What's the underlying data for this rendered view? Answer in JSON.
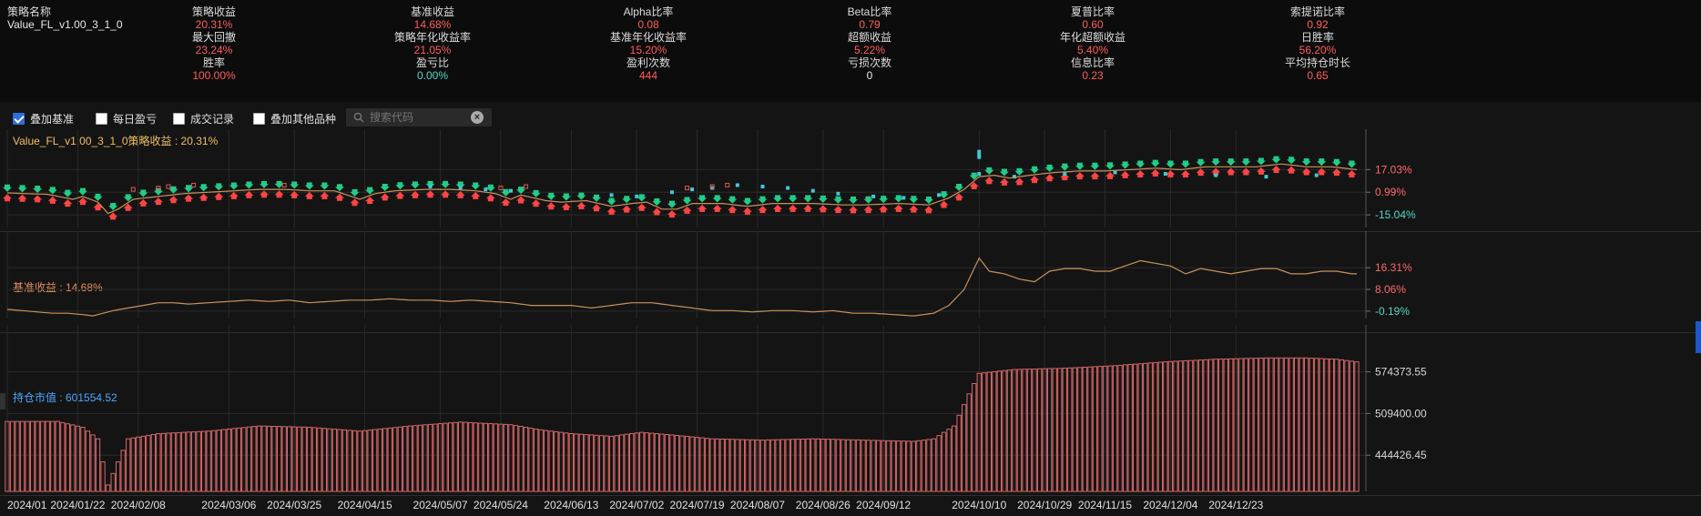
{
  "strategy": {
    "name_label": "策略名称",
    "name_value": "Value_FL_v1.00_3_1_0"
  },
  "stats": [
    {
      "label": "策略收益",
      "value": "20.31%",
      "color": "red"
    },
    {
      "label": "基准收益",
      "value": "14.68%",
      "color": "red"
    },
    {
      "label": "Alpha比率",
      "value": "0.08",
      "color": "red"
    },
    {
      "label": "Beta比率",
      "value": "0.79",
      "color": "red"
    },
    {
      "label": "夏普比率",
      "value": "0.60",
      "color": "red"
    },
    {
      "label": "索提诺比率",
      "value": "0.92",
      "color": "red"
    },
    {
      "label": "最大回撤",
      "value": "23.24%",
      "color": "red"
    },
    {
      "label": "策略年化收益率",
      "value": "21.05%",
      "color": "red"
    },
    {
      "label": "基准年化收益率",
      "value": "15.20%",
      "color": "red"
    },
    {
      "label": "超额收益",
      "value": "5.22%",
      "color": "red"
    },
    {
      "label": "年化超额收益",
      "value": "5.40%",
      "color": "red"
    },
    {
      "label": "日胜率",
      "value": "56.20%",
      "color": "red"
    },
    {
      "label": "胜率",
      "value": "100.00%",
      "color": "red"
    },
    {
      "label": "盈亏比",
      "value": "0.00%",
      "color": "teal"
    },
    {
      "label": "盈利次数",
      "value": "444",
      "color": "red"
    },
    {
      "label": "亏损次数",
      "value": "0",
      "color": "white"
    },
    {
      "label": "信息比率",
      "value": "0.23",
      "color": "red"
    },
    {
      "label": "平均持仓时长",
      "value": "0.65",
      "color": "red"
    }
  ],
  "toolbar": {
    "overlay_benchmark": {
      "label": "叠加基准",
      "checked": true
    },
    "daily_pnl": {
      "label": "每日盈亏",
      "checked": false
    },
    "trade_records": {
      "label": "成交记录",
      "checked": false
    },
    "overlay_other": {
      "label": "叠加其他品种",
      "checked": false
    },
    "search_placeholder": "搜索代码"
  },
  "panels": {
    "strategy_title": "Value_FL_v1.00_3_1_0策略收益 : 20.31%",
    "benchmark_title": "基准收益 : 14.68%",
    "position_title": "持仓市值 : 601554.52"
  },
  "colors": {
    "up": "#ff4444",
    "down": "#22cc88",
    "line": "#c8925a",
    "dash": "#40c8d8",
    "bar": "#d86868",
    "grid": "#2a2a2a"
  },
  "chart_data": [
    {
      "type": "line",
      "name": "strategy",
      "title": "Value_FL_v1.00_3_1_0策略收益 : 20.31%",
      "ytick_labels": [
        "17.03%",
        "0.99%",
        "-15.04%"
      ],
      "ytick_values": [
        17.03,
        0.99,
        -15.04
      ],
      "ylim": [
        -24,
        34
      ],
      "points": [
        [
          0,
          0.5
        ],
        [
          4,
          0
        ],
        [
          8,
          -0.5
        ],
        [
          13,
          -4
        ],
        [
          15,
          -2
        ],
        [
          18,
          -6
        ],
        [
          20,
          -14
        ],
        [
          22,
          -11
        ],
        [
          25,
          -4
        ],
        [
          30,
          -2
        ],
        [
          35,
          0
        ],
        [
          40,
          1
        ],
        [
          45,
          2
        ],
        [
          50,
          3
        ],
        [
          55,
          3
        ],
        [
          60,
          2
        ],
        [
          65,
          2
        ],
        [
          70,
          -4
        ],
        [
          73,
          0
        ],
        [
          77,
          2
        ],
        [
          83,
          3
        ],
        [
          88,
          3
        ],
        [
          93,
          2
        ],
        [
          97,
          0
        ],
        [
          100,
          -4
        ],
        [
          102,
          -1
        ],
        [
          107,
          -5
        ],
        [
          110,
          -6
        ],
        [
          115,
          -5
        ],
        [
          120,
          -9
        ],
        [
          124,
          -7
        ],
        [
          127,
          -6
        ],
        [
          130,
          -11
        ],
        [
          133,
          -11
        ],
        [
          136,
          -7
        ],
        [
          142,
          -7
        ],
        [
          147,
          -9
        ],
        [
          152,
          -7
        ],
        [
          160,
          -7
        ],
        [
          166,
          -8
        ],
        [
          170,
          -8
        ],
        [
          177,
          -7
        ],
        [
          183,
          -8
        ],
        [
          187,
          -3
        ],
        [
          190,
          3
        ],
        [
          193,
          12
        ],
        [
          196,
          13
        ],
        [
          199,
          11
        ],
        [
          203,
          13
        ],
        [
          208,
          15
        ],
        [
          213,
          16
        ],
        [
          218,
          16
        ],
        [
          223,
          17
        ],
        [
          228,
          18
        ],
        [
          233,
          17
        ],
        [
          238,
          19
        ],
        [
          243,
          19
        ],
        [
          248,
          19
        ],
        [
          253,
          21
        ],
        [
          258,
          19
        ],
        [
          263,
          19
        ],
        [
          268,
          17
        ]
      ],
      "marker_offset_up": -4,
      "marker_offset_down": 4,
      "dash_series": [
        [
          84,
          5
        ],
        [
          90,
          4
        ],
        [
          95,
          3
        ],
        [
          100,
          2
        ],
        [
          120,
          -1
        ],
        [
          125,
          -2
        ],
        [
          132,
          1
        ],
        [
          136,
          3
        ],
        [
          140,
          4
        ],
        [
          145,
          6
        ],
        [
          150,
          5
        ],
        [
          155,
          4
        ],
        [
          160,
          2
        ],
        [
          165,
          0
        ],
        [
          172,
          -2
        ],
        [
          178,
          -3
        ],
        [
          185,
          -1
        ],
        [
          193,
          14
        ],
        [
          200,
          12
        ],
        [
          210,
          14
        ],
        [
          220,
          15
        ],
        [
          230,
          14
        ],
        [
          240,
          13
        ],
        [
          250,
          12
        ],
        [
          260,
          13
        ]
      ],
      "red_square_points": [
        [
          25,
          3
        ],
        [
          30,
          4
        ],
        [
          32,
          5
        ],
        [
          37,
          6
        ],
        [
          55,
          6
        ],
        [
          98,
          4
        ],
        [
          103,
          5
        ],
        [
          135,
          4
        ],
        [
          140,
          5
        ],
        [
          143,
          6
        ]
      ]
    },
    {
      "type": "line",
      "name": "benchmark",
      "title": "基准收益 : 14.68%",
      "ytick_labels": [
        "16.31%",
        "8.06%",
        "-0.19%"
      ],
      "ytick_values": [
        16.31,
        8.06,
        -0.19
      ],
      "ylim": [
        -3,
        24
      ],
      "points": [
        [
          0,
          0.5
        ],
        [
          3,
          0
        ],
        [
          6,
          -0.5
        ],
        [
          9,
          -1
        ],
        [
          12,
          -1
        ],
        [
          15,
          -1.5
        ],
        [
          17,
          -2
        ],
        [
          19,
          -1
        ],
        [
          21,
          0
        ],
        [
          24,
          1
        ],
        [
          27,
          2
        ],
        [
          30,
          3
        ],
        [
          33,
          3
        ],
        [
          36,
          2.5
        ],
        [
          40,
          3
        ],
        [
          44,
          3.5
        ],
        [
          48,
          4
        ],
        [
          52,
          3.5
        ],
        [
          56,
          4
        ],
        [
          60,
          3
        ],
        [
          64,
          3.5
        ],
        [
          68,
          4
        ],
        [
          72,
          4
        ],
        [
          76,
          4.5
        ],
        [
          80,
          4
        ],
        [
          84,
          4
        ],
        [
          88,
          3.5
        ],
        [
          92,
          4
        ],
        [
          96,
          3.5
        ],
        [
          100,
          3
        ],
        [
          104,
          2
        ],
        [
          108,
          2
        ],
        [
          112,
          2
        ],
        [
          116,
          1
        ],
        [
          120,
          2
        ],
        [
          124,
          3
        ],
        [
          128,
          3
        ],
        [
          132,
          2
        ],
        [
          136,
          1
        ],
        [
          140,
          0
        ],
        [
          144,
          0
        ],
        [
          148,
          -0.5
        ],
        [
          152,
          0
        ],
        [
          156,
          0
        ],
        [
          160,
          -0.5
        ],
        [
          164,
          0
        ],
        [
          168,
          -1
        ],
        [
          172,
          -1
        ],
        [
          176,
          -1.5
        ],
        [
          180,
          -2
        ],
        [
          184,
          -1
        ],
        [
          187,
          2
        ],
        [
          190,
          8
        ],
        [
          193,
          20
        ],
        [
          195,
          15
        ],
        [
          198,
          14
        ],
        [
          201,
          12
        ],
        [
          204,
          11
        ],
        [
          207,
          15
        ],
        [
          210,
          16
        ],
        [
          213,
          16
        ],
        [
          216,
          15
        ],
        [
          219,
          15
        ],
        [
          222,
          17
        ],
        [
          225,
          19
        ],
        [
          228,
          18
        ],
        [
          231,
          17
        ],
        [
          234,
          14
        ],
        [
          237,
          16
        ],
        [
          240,
          15
        ],
        [
          243,
          14
        ],
        [
          246,
          15
        ],
        [
          249,
          16
        ],
        [
          252,
          16
        ],
        [
          255,
          14
        ],
        [
          258,
          14
        ],
        [
          261,
          15
        ],
        [
          264,
          15
        ],
        [
          267,
          14
        ]
      ]
    },
    {
      "type": "bar",
      "name": "position_value",
      "title": "持仓市值 : 601554.52",
      "ytick_labels": [
        "574373.55",
        "509400.00",
        "444426.45"
      ],
      "ytick_values": [
        574373.55,
        509400.0,
        444426.45
      ],
      "ylim": [
        388000,
        622000
      ],
      "categories": [
        "2024/01",
        "2024/01/22",
        "2024/02/08",
        "2024/03/06",
        "2024/03/25",
        "2024/04/15",
        "2024/05/07",
        "2024/05/24",
        "2024/06/13",
        "2024/07/02",
        "2024/07/19",
        "2024/08/07",
        "2024/08/26",
        "2024/09/12",
        "2024/10/10",
        "2024/10/29",
        "2024/11/15",
        "2024/12/04",
        "2024/12/23"
      ],
      "values_profile": [
        [
          0,
          497000
        ],
        [
          10,
          497000
        ],
        [
          15,
          488000
        ],
        [
          18,
          470000
        ],
        [
          20,
          398000
        ],
        [
          24,
          470000
        ],
        [
          30,
          478000
        ],
        [
          40,
          482000
        ],
        [
          50,
          490000
        ],
        [
          60,
          488000
        ],
        [
          70,
          482000
        ],
        [
          80,
          490000
        ],
        [
          90,
          496000
        ],
        [
          100,
          492000
        ],
        [
          106,
          484000
        ],
        [
          112,
          478000
        ],
        [
          120,
          474000
        ],
        [
          126,
          480000
        ],
        [
          132,
          476000
        ],
        [
          140,
          470000
        ],
        [
          150,
          468000
        ],
        [
          160,
          470000
        ],
        [
          170,
          468000
        ],
        [
          180,
          466000
        ],
        [
          184,
          470000
        ],
        [
          188,
          490000
        ],
        [
          191,
          540000
        ],
        [
          193,
          572000
        ],
        [
          200,
          578000
        ],
        [
          210,
          580000
        ],
        [
          220,
          584000
        ],
        [
          230,
          590000
        ],
        [
          240,
          594000
        ],
        [
          250,
          596000
        ],
        [
          258,
          596000
        ],
        [
          264,
          594000
        ],
        [
          268,
          590000
        ]
      ]
    }
  ],
  "x_axis_labels": [
    "2024/01",
    "2024/01/22",
    "2024/02/08",
    "2024/03/06",
    "2024/03/25",
    "2024/04/15",
    "2024/05/07",
    "2024/05/24",
    "2024/06/13",
    "2024/07/02",
    "2024/07/19",
    "2024/08/07",
    "2024/08/26",
    "2024/09/12",
    "2024/10/10",
    "2024/10/29",
    "2024/11/15",
    "2024/12/04",
    "2024/12/23"
  ],
  "x_axis_label_indices": [
    0,
    14,
    26,
    44,
    57,
    71,
    86,
    98,
    112,
    125,
    137,
    149,
    162,
    174,
    193,
    206,
    218,
    231,
    244
  ]
}
